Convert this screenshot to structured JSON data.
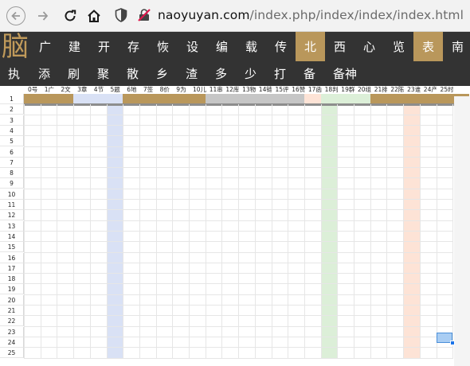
{
  "browser": {
    "url_host": "naoyuyan.com",
    "url_path": "/index.php/index/index/index.html"
  },
  "site": {
    "logo_char": "脑",
    "menu_row1": [
      {
        "label": "广",
        "active": false
      },
      {
        "label": "建",
        "active": false
      },
      {
        "label": "开",
        "active": false
      },
      {
        "label": "存",
        "active": false
      },
      {
        "label": "恢",
        "active": false
      },
      {
        "label": "设",
        "active": false
      },
      {
        "label": "编",
        "active": false
      },
      {
        "label": "载",
        "active": false
      },
      {
        "label": "传",
        "active": false
      },
      {
        "label": "北",
        "active": true
      },
      {
        "label": "西",
        "active": false
      },
      {
        "label": "心",
        "active": false
      },
      {
        "label": "览",
        "active": false
      },
      {
        "label": "表",
        "active": true
      },
      {
        "label": "南",
        "active": false
      }
    ],
    "menu_row2": [
      "执",
      "添",
      "刷",
      "聚",
      "散",
      "乡",
      "渣",
      "多",
      "少",
      "打",
      "备",
      "备神"
    ]
  },
  "sheet": {
    "columns": [
      "0号",
      "1广",
      "2文",
      "3章",
      "4节",
      "5题",
      "6地",
      "7签",
      "8价",
      "9为",
      "10儿",
      "11串",
      "12库",
      "13物",
      "14链",
      "15评",
      "16赞",
      "17函",
      "18判",
      "19群",
      "20组",
      "21排",
      "22陈",
      "23谁",
      "24产",
      "25时"
    ],
    "rows": [
      "1",
      "2",
      "3",
      "4",
      "5",
      "6",
      "7",
      "8",
      "9",
      "10",
      "11",
      "12",
      "13",
      "14",
      "15",
      "16",
      "17",
      "18",
      "19",
      "20",
      "21",
      "22",
      "23",
      "24",
      "25"
    ],
    "colors": {
      "gold": "#b9975b",
      "blue_band": "#d9e1f5",
      "green_band": "#dcefd8",
      "peach_band": "#fde3d6",
      "gray_band": "#c6c6c6"
    }
  }
}
